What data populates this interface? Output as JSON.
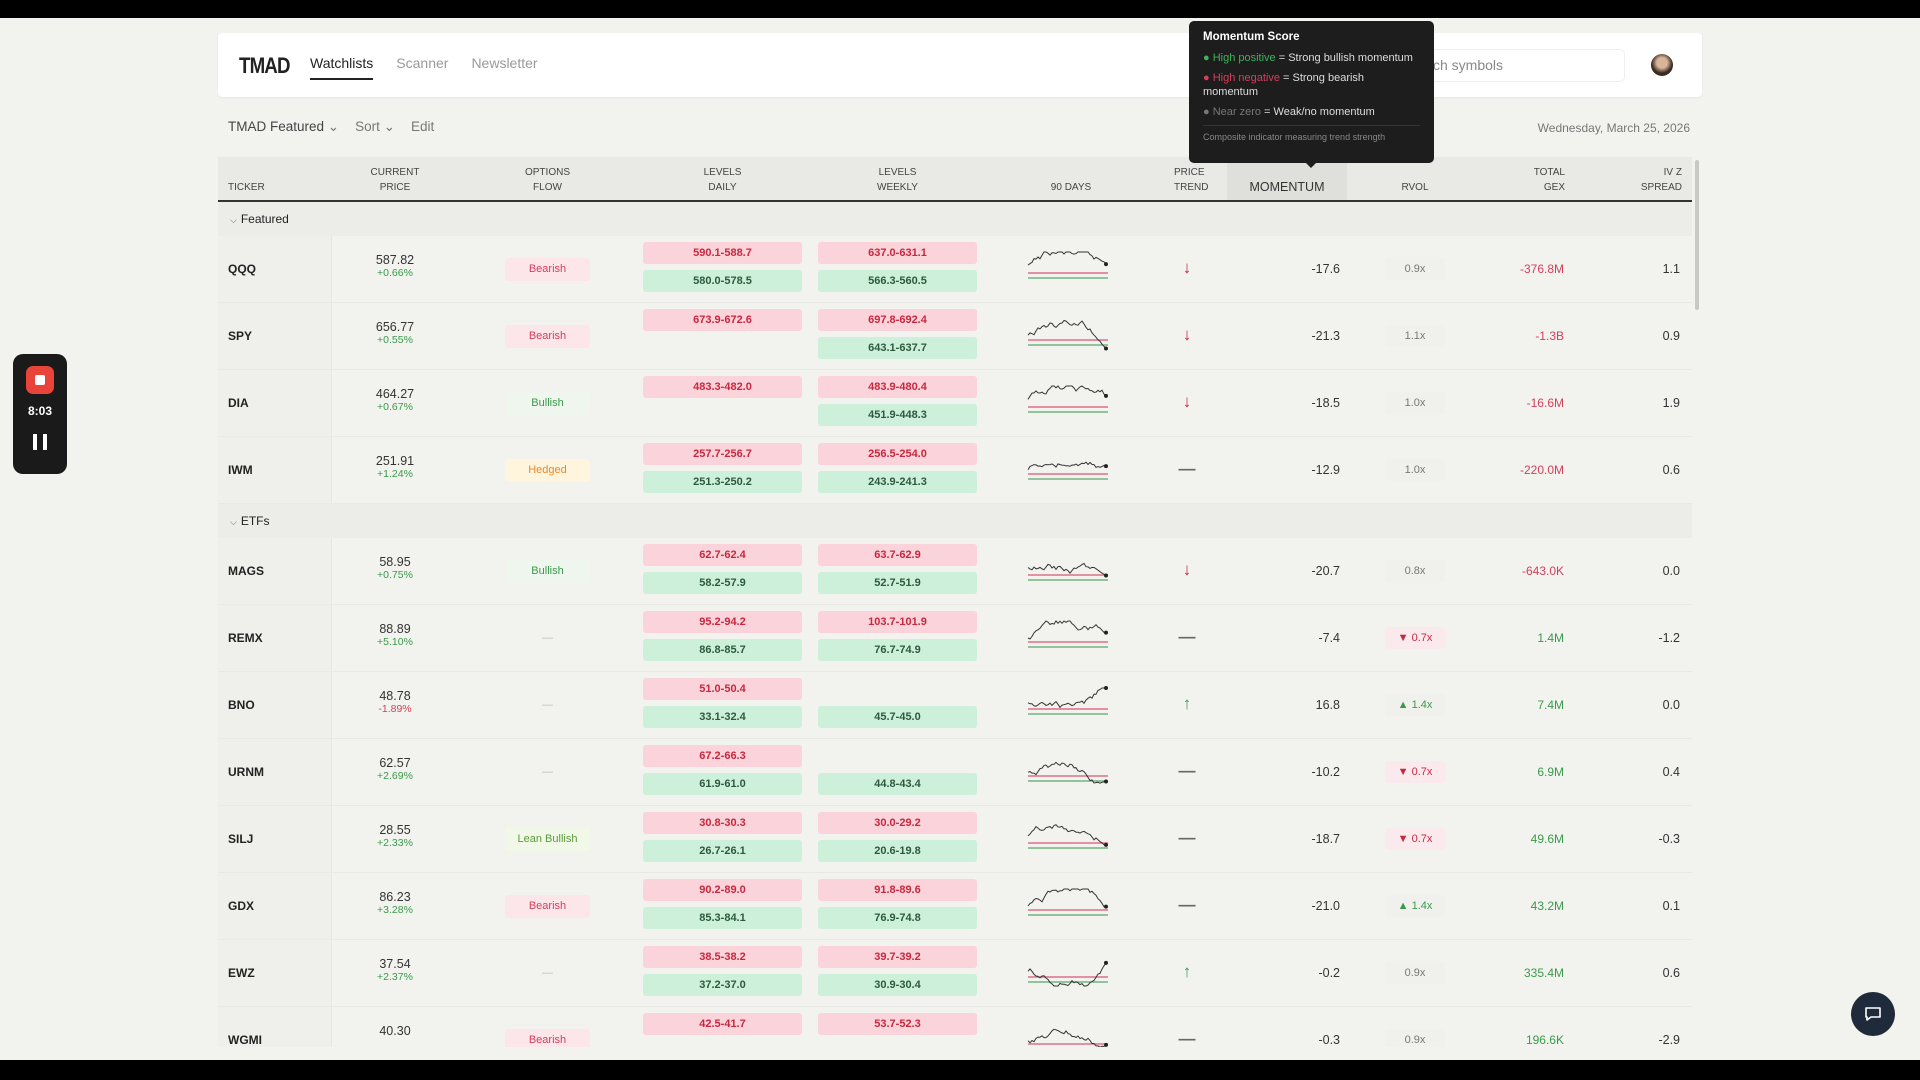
{
  "app": {
    "logo": "TMAD",
    "nav": [
      "Watchlists",
      "Scanner",
      "Newsletter"
    ],
    "active_nav": "Watchlists",
    "search_placeholder": "Search symbols",
    "search_visible": "ch symbols"
  },
  "tooltip": {
    "title": "Momentum Score",
    "pos_label": "● High positive",
    "pos_text": " = Strong bullish momentum",
    "neg_label": "● High negative",
    "neg_text": " = Strong bearish momentum",
    "zero_label": "● Near zero",
    "zero_text": " = Weak/no momentum",
    "footer": "Composite indicator measuring trend strength"
  },
  "toolbar": {
    "watchlist": "TMAD Featured",
    "sort": "Sort",
    "edit": "Edit",
    "date": "Wednesday, March 25, 2026"
  },
  "columns": [
    [
      "",
      "TICKER"
    ],
    [
      "CURRENT",
      "PRICE"
    ],
    [
      "OPTIONS",
      "FLOW"
    ],
    [
      "LEVELS",
      "DAILY"
    ],
    [
      "LEVELS",
      "WEEKLY"
    ],
    [
      "",
      "90 DAYS"
    ],
    [
      "PRICE",
      "TREND"
    ],
    [
      "",
      "MOMENTUM"
    ],
    [
      "",
      "RVOL"
    ],
    [
      "TOTAL",
      "GEX"
    ],
    [
      "IV Z",
      "SPREAD"
    ]
  ],
  "recorder": {
    "time": "8:03"
  },
  "colors": {
    "bearish": "#d2405a",
    "bullish": "#3a9a4a",
    "hedged": "#e88a2c",
    "resistance_bg": "#fbd3da",
    "support_bg": "#cdf0da"
  },
  "groups": [
    {
      "name": "Featured",
      "rows": [
        {
          "ticker": "QQQ",
          "price": "587.82",
          "change": "+0.66%",
          "flow": "Bearish",
          "daily": [
            "590.1-588.7",
            "580.0-578.5"
          ],
          "weekly": [
            "637.0-631.1",
            "566.3-560.5"
          ],
          "trend": "down",
          "momentum": "-17.6",
          "rvol": "0.9x",
          "rvol_dir": "",
          "gex": "-376.8M",
          "iv": "1.1"
        },
        {
          "ticker": "SPY",
          "price": "656.77",
          "change": "+0.55%",
          "flow": "Bearish",
          "daily": [
            "673.9-672.6",
            ""
          ],
          "weekly": [
            "697.8-692.4",
            "643.1-637.7"
          ],
          "trend": "down",
          "momentum": "-21.3",
          "rvol": "1.1x",
          "rvol_dir": "",
          "gex": "-1.3B",
          "iv": "0.9"
        },
        {
          "ticker": "DIA",
          "price": "464.27",
          "change": "+0.67%",
          "flow": "Bullish",
          "daily": [
            "483.3-482.0",
            ""
          ],
          "weekly": [
            "483.9-480.4",
            "451.9-448.3"
          ],
          "trend": "down",
          "momentum": "-18.5",
          "rvol": "1.0x",
          "rvol_dir": "",
          "gex": "-16.6M",
          "iv": "1.9"
        },
        {
          "ticker": "IWM",
          "price": "251.91",
          "change": "+1.24%",
          "flow": "Hedged",
          "daily": [
            "257.7-256.7",
            "251.3-250.2"
          ],
          "weekly": [
            "256.5-254.0",
            "243.9-241.3"
          ],
          "trend": "flat",
          "momentum": "-12.9",
          "rvol": "1.0x",
          "rvol_dir": "",
          "gex": "-220.0M",
          "iv": "0.6"
        }
      ]
    },
    {
      "name": "ETFs",
      "rows": [
        {
          "ticker": "MAGS",
          "price": "58.95",
          "change": "+0.75%",
          "flow": "Bullish",
          "daily": [
            "62.7-62.4",
            "58.2-57.9"
          ],
          "weekly": [
            "63.7-62.9",
            "52.7-51.9"
          ],
          "trend": "down",
          "momentum": "-20.7",
          "rvol": "0.8x",
          "rvol_dir": "",
          "gex": "-643.0K",
          "iv": "0.0"
        },
        {
          "ticker": "REMX",
          "price": "88.89",
          "change": "+5.10%",
          "flow": "—",
          "daily": [
            "95.2-94.2",
            "86.8-85.7"
          ],
          "weekly": [
            "103.7-101.9",
            "76.7-74.9"
          ],
          "trend": "flat",
          "momentum": "-7.4",
          "rvol": "0.7x",
          "rvol_dir": "lo",
          "gex": "1.4M",
          "iv": "-1.2"
        },
        {
          "ticker": "BNO",
          "price": "48.78",
          "change": "-1.89%",
          "flow": "—",
          "daily": [
            "51.0-50.4",
            "33.1-32.4"
          ],
          "weekly": [
            "",
            "45.7-45.0"
          ],
          "trend": "up",
          "momentum": "16.8",
          "rvol": "1.4x",
          "rvol_dir": "hi",
          "gex": "7.4M",
          "iv": "0.0"
        },
        {
          "ticker": "URNM",
          "price": "62.57",
          "change": "+2.69%",
          "flow": "—",
          "daily": [
            "67.2-66.3",
            "61.9-61.0"
          ],
          "weekly": [
            "",
            "44.8-43.4"
          ],
          "trend": "flat",
          "momentum": "-10.2",
          "rvol": "0.7x",
          "rvol_dir": "lo",
          "gex": "6.9M",
          "iv": "0.4"
        },
        {
          "ticker": "SILJ",
          "price": "28.55",
          "change": "+2.33%",
          "flow": "Lean Bullish",
          "daily": [
            "30.8-30.3",
            "26.7-26.1"
          ],
          "weekly": [
            "30.0-29.2",
            "20.6-19.8"
          ],
          "trend": "flat",
          "momentum": "-18.7",
          "rvol": "0.7x",
          "rvol_dir": "lo",
          "gex": "49.6M",
          "iv": "-0.3"
        },
        {
          "ticker": "GDX",
          "price": "86.23",
          "change": "+3.28%",
          "flow": "Bearish",
          "daily": [
            "90.2-89.0",
            "85.3-84.1"
          ],
          "weekly": [
            "91.8-89.6",
            "76.9-74.8"
          ],
          "trend": "flat",
          "momentum": "-21.0",
          "rvol": "1.4x",
          "rvol_dir": "hi",
          "gex": "43.2M",
          "iv": "0.1"
        },
        {
          "ticker": "EWZ",
          "price": "37.54",
          "change": "+2.37%",
          "flow": "—",
          "daily": [
            "38.5-38.2",
            "37.2-37.0"
          ],
          "weekly": [
            "39.7-39.2",
            "30.9-30.4"
          ],
          "trend": "up",
          "momentum": "-0.2",
          "rvol": "0.9x",
          "rvol_dir": "",
          "gex": "335.4M",
          "iv": "0.6"
        },
        {
          "ticker": "WGMI",
          "price": "40.30",
          "change": "",
          "flow": "Bearish",
          "daily": [
            "42.5-41.7",
            ""
          ],
          "weekly": [
            "53.7-52.3",
            ""
          ],
          "trend": "flat",
          "momentum": "-0.3",
          "rvol": "0.9x",
          "rvol_dir": "",
          "gex": "196.6K",
          "iv": "-2.9"
        }
      ]
    }
  ]
}
